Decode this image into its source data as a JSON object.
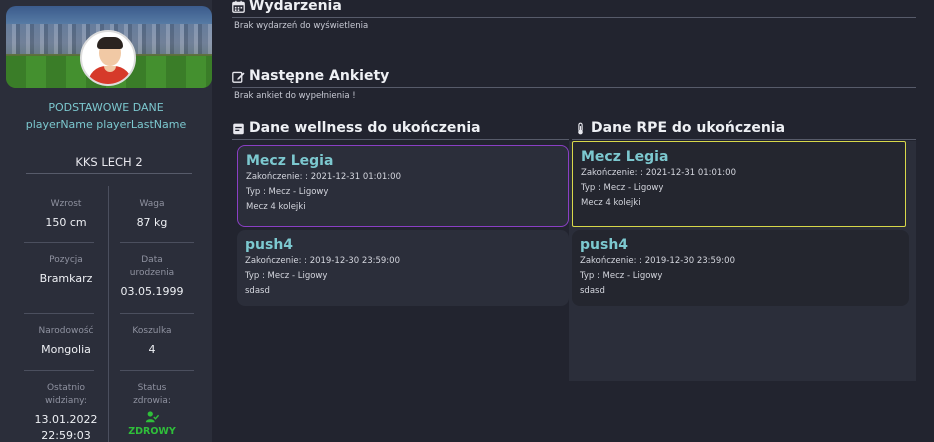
{
  "profile": {
    "section_title": "PODSTAWOWE DANE",
    "player_name": "playerName playerLastName",
    "team": "KKS LECH 2",
    "height_label": "Wzrost",
    "height_value": "150 cm",
    "weight_label": "Waga",
    "weight_value": "87 kg",
    "position_label": "Pozycja",
    "position_value": "Bramkarz",
    "birth_label_1": "Data",
    "birth_label_2": "urodzenia",
    "birth_value": "03.05.1999",
    "nationality_label": "Narodowość",
    "nationality_value": "Mongolia",
    "shirt_label": "Koszulka",
    "shirt_value": "4",
    "last_seen_label_1": "Ostatnio",
    "last_seen_label_2": "widziany:",
    "last_seen_date": "13.01.2022",
    "last_seen_time": "22:59:03",
    "health_label_1": "Status",
    "health_label_2": "zdrowia:",
    "health_value": "ZDROWY",
    "health_color": "#2fbf3a"
  },
  "events": {
    "title": "Wydarzenia",
    "empty": "Brak wydarzeń do wyświetlenia",
    "icon": "calendar-icon"
  },
  "surveys": {
    "title": "Następne Ankiety",
    "empty": "Brak ankiet do wypełnienia !",
    "icon": "edit-icon"
  },
  "wellness": {
    "title": "Dane wellness do ukończenia",
    "icon": "clipboard-icon",
    "cards": [
      {
        "title": "Mecz Legia",
        "end": "Zakończenie: : 2021-12-31 01:01:00",
        "type": "Typ : Mecz - Ligowy",
        "desc": "Mecz 4 kolejki"
      },
      {
        "title": "push4",
        "end": "Zakończenie: : 2019-12-30 23:59:00",
        "type": "Typ : Mecz - Ligowy",
        "desc": "sdasd"
      }
    ]
  },
  "rpe": {
    "title": "Dane RPE do ukończenia",
    "icon": "thermometer-icon",
    "cards": [
      {
        "title": "Mecz Legia",
        "end": "Zakończenie: : 2021-12-31 01:01:00",
        "type": "Typ : Mecz - Ligowy",
        "desc": "Mecz 4 kolejki"
      },
      {
        "title": "push4",
        "end": "Zakończenie: : 2019-12-30 23:59:00",
        "type": "Typ : Mecz - Ligowy",
        "desc": "sdasd"
      }
    ]
  },
  "colors": {
    "accent": "#7cc8cf",
    "wellness_highlight": "#8a3fc4",
    "rpe_highlight": "#d8d84a"
  }
}
